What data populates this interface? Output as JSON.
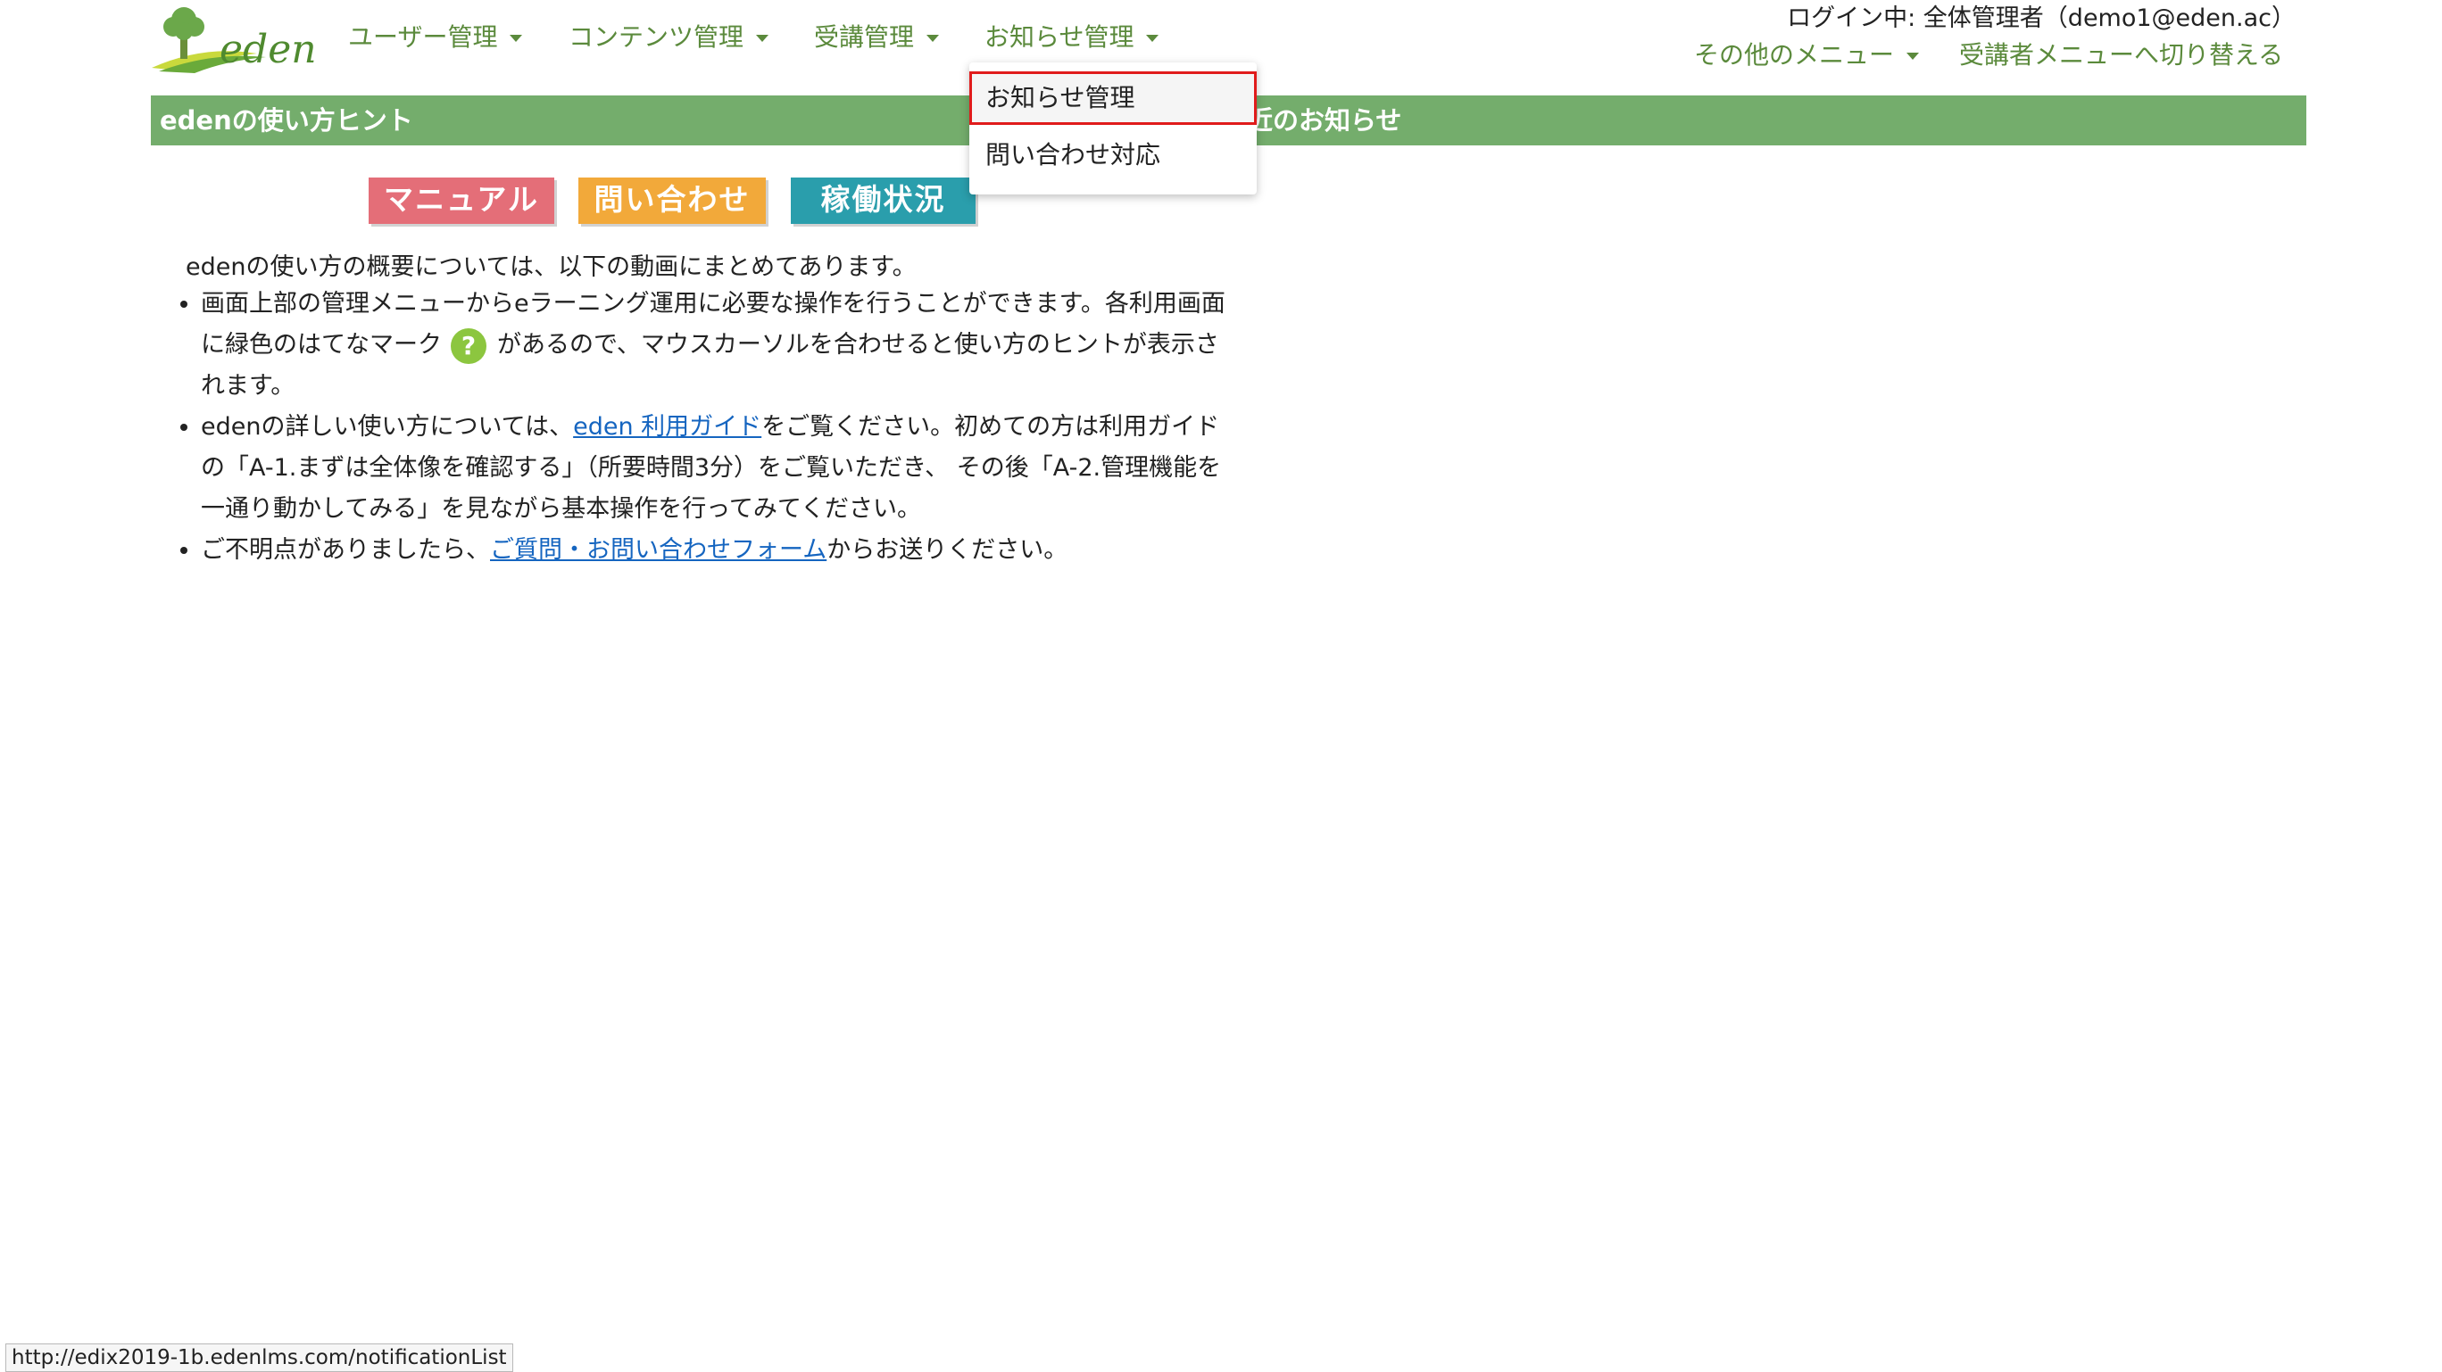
{
  "logo": {
    "text": "eden"
  },
  "nav": {
    "items": [
      {
        "label": "ユーザー管理"
      },
      {
        "label": "コンテンツ管理"
      },
      {
        "label": "受講管理"
      },
      {
        "label": "お知らせ管理"
      }
    ],
    "login_info": "ログイン中: 全体管理者（demo1@eden.ac）",
    "other_menu": "その他のメニュー",
    "switch_menu": "受講者メニューへ切り替える"
  },
  "dropdown": {
    "items": [
      {
        "label": "お知らせ管理"
      },
      {
        "label": "問い合わせ対応"
      }
    ]
  },
  "bar": {
    "left_title": "edenの使い方ヒント",
    "right_title": "最近のお知らせ",
    "right_title_visible": "近のお知らせ"
  },
  "buttons": {
    "manual": "マニュアル",
    "inquiry": "問い合わせ",
    "status": "稼働状況"
  },
  "content": {
    "intro": "edenの使い方の概要については、以下の動画にまとめてあります。",
    "tip1_part1": "画面上部の管理メニューからeラーニング運用に必要な操作を行うことができます。各利用画面に緑色のはてなマーク",
    "tip1_icon": "?",
    "tip1_part2": "があるので、マウスカーソルを合わせると使い方のヒントが表示されます。",
    "tip2_part1": "edenの詳しい使い方については、",
    "tip2_link": "eden 利用ガイド",
    "tip2_part2": "をご覧ください。初めての方は利用ガイドの「A-1.まずは全体像を確認する」（所要時間3分）をご覧いただき、 その後「A-2.管理機能を一通り動かしてみる」を見ながら基本操作を行ってみてください。",
    "tip3_part1": "ご不明点がありましたら、",
    "tip3_link": "ご質問・お問い合わせフォーム",
    "tip3_part2": "からお送りください。"
  },
  "statusbar": {
    "url": "http://edix2019-1b.edenlms.com/notificationList"
  },
  "colors": {
    "nav_green": "#5b8a3c",
    "bar_green": "#74ad6c",
    "manual": "#e46e78",
    "inquiry": "#f2a93a",
    "status": "#2a9eac",
    "highlight": "#e01b1b"
  }
}
